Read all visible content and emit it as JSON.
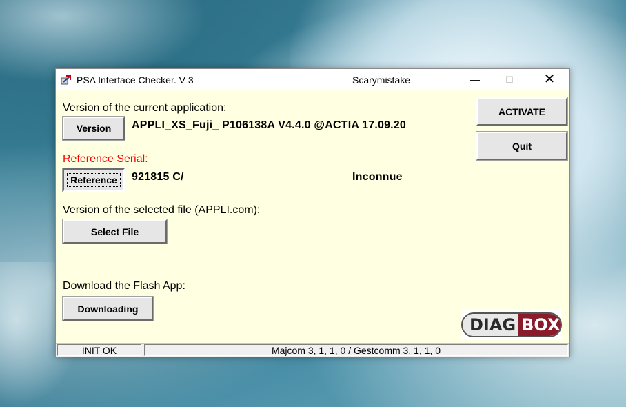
{
  "window": {
    "title": "PSA Interface Checker. V 3",
    "user": "Scarymistake",
    "controls": {
      "minimize": "—",
      "maximize": "☐",
      "close": "✕"
    }
  },
  "sections": {
    "current_app_label": "Version of the current application:",
    "version_button": "Version",
    "current_app_value": "APPLI_XS_Fuji_ P106138A  V4.4.0 @ACTIA 17.09.20",
    "reference_label": "Reference Serial:",
    "reference_button": "Reference",
    "reference_value": "921815  C/",
    "reference_status": "Inconnue",
    "selected_file_label": "Version of the selected file (APPLI.com):",
    "select_file_button": "Select File",
    "download_label": "Download the Flash App:",
    "download_button": "Downloading"
  },
  "actions": {
    "activate": "ACTIVATE",
    "quit": "Quit"
  },
  "logo": {
    "part1": "DIAG",
    "part2": "BOX",
    "brand_color": "#8b1a2b"
  },
  "status": {
    "left": "INIT OK",
    "right": "Majcom 3, 1, 1, 0 / Gestcomm 3, 1, 1, 0"
  },
  "colors": {
    "window_bg": "#ffffe1",
    "accent_red": "#ff0000"
  }
}
